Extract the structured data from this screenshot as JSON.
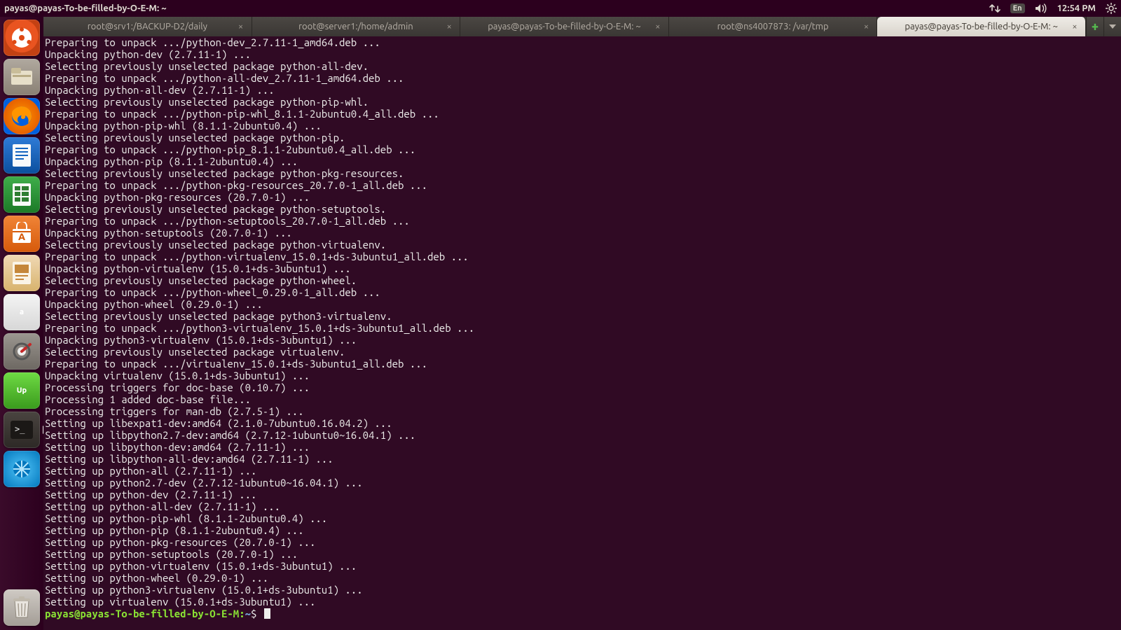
{
  "menubar": {
    "title": "payas@payas-To-be-filled-by-O-E-M: ~",
    "lang": "En",
    "clock": "12:54 PM"
  },
  "launcher": {
    "items": [
      {
        "name": "dash",
        "label": ""
      },
      {
        "name": "files",
        "label": ""
      },
      {
        "name": "firefox",
        "label": ""
      },
      {
        "name": "writer",
        "label": ""
      },
      {
        "name": "calc",
        "label": ""
      },
      {
        "name": "software",
        "label": ""
      },
      {
        "name": "impress",
        "label": ""
      },
      {
        "name": "amazon",
        "label": "a"
      },
      {
        "name": "settings",
        "label": ""
      },
      {
        "name": "upwork",
        "label": "Up"
      },
      {
        "name": "terminal-ic",
        "label": ">_"
      },
      {
        "name": "extra",
        "label": ""
      }
    ],
    "trash": {
      "label": ""
    }
  },
  "tabs": [
    {
      "label": "root@srv1:/BACKUP-D2/daily",
      "active": false
    },
    {
      "label": "root@server1:/home/admin",
      "active": false
    },
    {
      "label": "payas@payas-To-be-filled-by-O-E-M: ~",
      "active": false
    },
    {
      "label": "root@ns4007873: /var/tmp",
      "active": false
    },
    {
      "label": "payas@payas-To-be-filled-by-O-E-M: ~",
      "active": true
    }
  ],
  "prompt": {
    "user_host": "payas@payas-To-be-filled-by-O-E-M",
    "path": "~",
    "sep": ":",
    "end": "$"
  },
  "terminal_lines": [
    "Preparing to unpack .../python-dev_2.7.11-1_amd64.deb ...",
    "Unpacking python-dev (2.7.11-1) ...",
    "Selecting previously unselected package python-all-dev.",
    "Preparing to unpack .../python-all-dev_2.7.11-1_amd64.deb ...",
    "Unpacking python-all-dev (2.7.11-1) ...",
    "Selecting previously unselected package python-pip-whl.",
    "Preparing to unpack .../python-pip-whl_8.1.1-2ubuntu0.4_all.deb ...",
    "Unpacking python-pip-whl (8.1.1-2ubuntu0.4) ...",
    "Selecting previously unselected package python-pip.",
    "Preparing to unpack .../python-pip_8.1.1-2ubuntu0.4_all.deb ...",
    "Unpacking python-pip (8.1.1-2ubuntu0.4) ...",
    "Selecting previously unselected package python-pkg-resources.",
    "Preparing to unpack .../python-pkg-resources_20.7.0-1_all.deb ...",
    "Unpacking python-pkg-resources (20.7.0-1) ...",
    "Selecting previously unselected package python-setuptools.",
    "Preparing to unpack .../python-setuptools_20.7.0-1_all.deb ...",
    "Unpacking python-setuptools (20.7.0-1) ...",
    "Selecting previously unselected package python-virtualenv.",
    "Preparing to unpack .../python-virtualenv_15.0.1+ds-3ubuntu1_all.deb ...",
    "Unpacking python-virtualenv (15.0.1+ds-3ubuntu1) ...",
    "Selecting previously unselected package python-wheel.",
    "Preparing to unpack .../python-wheel_0.29.0-1_all.deb ...",
    "Unpacking python-wheel (0.29.0-1) ...",
    "Selecting previously unselected package python3-virtualenv.",
    "Preparing to unpack .../python3-virtualenv_15.0.1+ds-3ubuntu1_all.deb ...",
    "Unpacking python3-virtualenv (15.0.1+ds-3ubuntu1) ...",
    "Selecting previously unselected package virtualenv.",
    "Preparing to unpack .../virtualenv_15.0.1+ds-3ubuntu1_all.deb ...",
    "Unpacking virtualenv (15.0.1+ds-3ubuntu1) ...",
    "Processing triggers for doc-base (0.10.7) ...",
    "Processing 1 added doc-base file...",
    "Processing triggers for man-db (2.7.5-1) ...",
    "Setting up libexpat1-dev:amd64 (2.1.0-7ubuntu0.16.04.2) ...",
    "Setting up libpython2.7-dev:amd64 (2.7.12-1ubuntu0~16.04.1) ...",
    "Setting up libpython-dev:amd64 (2.7.11-1) ...",
    "Setting up libpython-all-dev:amd64 (2.7.11-1) ...",
    "Setting up python-all (2.7.11-1) ...",
    "Setting up python2.7-dev (2.7.12-1ubuntu0~16.04.1) ...",
    "Setting up python-dev (2.7.11-1) ...",
    "Setting up python-all-dev (2.7.11-1) ...",
    "Setting up python-pip-whl (8.1.1-2ubuntu0.4) ...",
    "Setting up python-pip (8.1.1-2ubuntu0.4) ...",
    "Setting up python-pkg-resources (20.7.0-1) ...",
    "Setting up python-setuptools (20.7.0-1) ...",
    "Setting up python-virtualenv (15.0.1+ds-3ubuntu1) ...",
    "Setting up python-wheel (0.29.0-1) ...",
    "Setting up python3-virtualenv (15.0.1+ds-3ubuntu1) ...",
    "Setting up virtualenv (15.0.1+ds-3ubuntu1) ..."
  ]
}
